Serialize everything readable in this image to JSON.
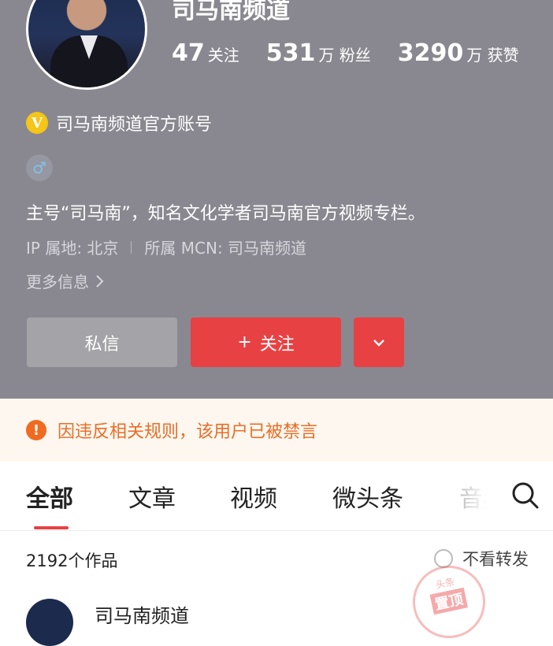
{
  "profile": {
    "name": "司马南频道",
    "stats": [
      {
        "num": "47",
        "label": "关注"
      },
      {
        "num": "531",
        "label": "万 粉丝"
      },
      {
        "num": "3290",
        "label": "万 获赞"
      }
    ],
    "verified_badge": "V",
    "verified_text": "司马南频道官方账号",
    "gender_symbol": "♂",
    "bio": "主号“司马南”，知名文化学者司马南官方视频专栏。",
    "ip": "IP 属地: 北京",
    "mcn": "所属 MCN: 司马南频道",
    "more_info": "更多信息"
  },
  "actions": {
    "message": "私信",
    "follow_plus": "+",
    "follow": "关注"
  },
  "notice": {
    "icon_text": "!",
    "text": "因违反相关规则，该用户已被禁言"
  },
  "tabs": [
    {
      "label": "全部",
      "active": true
    },
    {
      "label": "文章"
    },
    {
      "label": "视频"
    },
    {
      "label": "微头条"
    },
    {
      "label": "音频"
    }
  ],
  "works": {
    "count": "2192个作品",
    "no_repost": "不看转发"
  },
  "post": {
    "author": "司马南频道"
  },
  "stamp": {
    "top": "头条",
    "main": "置顶"
  },
  "colors": {
    "header_bg": "#898890",
    "accent": "#e84143",
    "notice_text": "#e86e28",
    "notice_bg": "#fdf7ef"
  },
  "icons": [
    "v-badge-icon",
    "male-icon",
    "chevron-right-icon",
    "chevron-down-icon",
    "alert-icon",
    "search-icon"
  ]
}
